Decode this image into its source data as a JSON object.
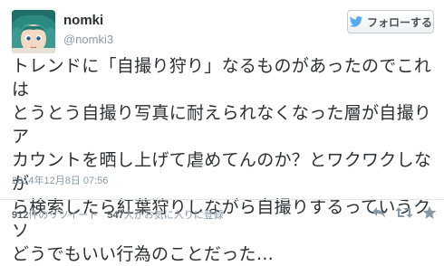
{
  "user": {
    "name": "nomki",
    "handle": "@nomki3"
  },
  "follow_button": {
    "label": "フォローする"
  },
  "tweet": {
    "text": "トレンドに「自撮り狩り」なるものがあったのでこれは\nとうとう自撮り写真に耐えられなくなった層が自撮りア\nカウントを晒し上げて虐めてんのか？とワクワクしなが\nら検索したら紅葉狩りしながら自撮りするっていうクソ\nどうでもいい行為のことだった…",
    "timestamp": "2014年12月8日 07:56"
  },
  "stats": {
    "retweet_count": "912",
    "retweet_label": "件のリツイート",
    "favorite_count": "547",
    "favorite_label": "人がお気に入りに登録"
  },
  "colors": {
    "twitter_blue": "#55acee",
    "muted_text": "#8899a6",
    "body_text": "#292f33"
  },
  "icons": [
    "avatar",
    "twitter-bird-icon",
    "reply-icon",
    "retweet-icon",
    "favorite-star-icon"
  ]
}
